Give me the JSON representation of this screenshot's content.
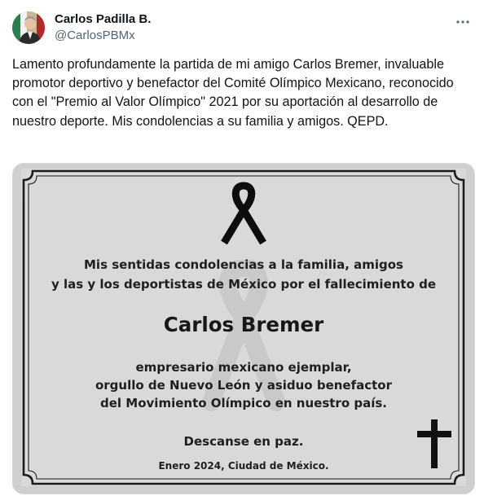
{
  "author": {
    "display_name": "Carlos Padilla B.",
    "handle": "@CarlosPBMx",
    "avatar_icon": "profile-photo"
  },
  "header": {
    "more_icon": "more-horizontal-icon"
  },
  "tweet": {
    "text": "Lamento profundamente la partida de mi amigo Carlos Bremer, invaluable promotor deportivo y benefactor del Comité Olímpico Mexicano, reconocido con el \"Premio al Valor Olímpico\" 2021 por su aportación al desarrollo de nuestro deporte. Mis condolencias a su familia y amigos. QEPD."
  },
  "media": {
    "ribbon_icon": "mourning-ribbon-icon",
    "cross_icon": "cross-icon",
    "line1": "Mis sentidas condolencias a la familia, amigos",
    "line2": "y las y los deportistas de México por el fallecimiento de",
    "name": "Carlos Bremer",
    "line3": "empresario mexicano ejemplar,",
    "line4": "orgullo de Nuevo León y asiduo benefactor",
    "line5": "del Movimiento Olímpico en nuestro país.",
    "line6": "Descanse en paz.",
    "line7": "Enero 2024, Ciudad de México.",
    "colors": {
      "card_background": "#d9d9d9",
      "frame": "#1a1a1a",
      "ink": "#1f1f1f"
    }
  }
}
